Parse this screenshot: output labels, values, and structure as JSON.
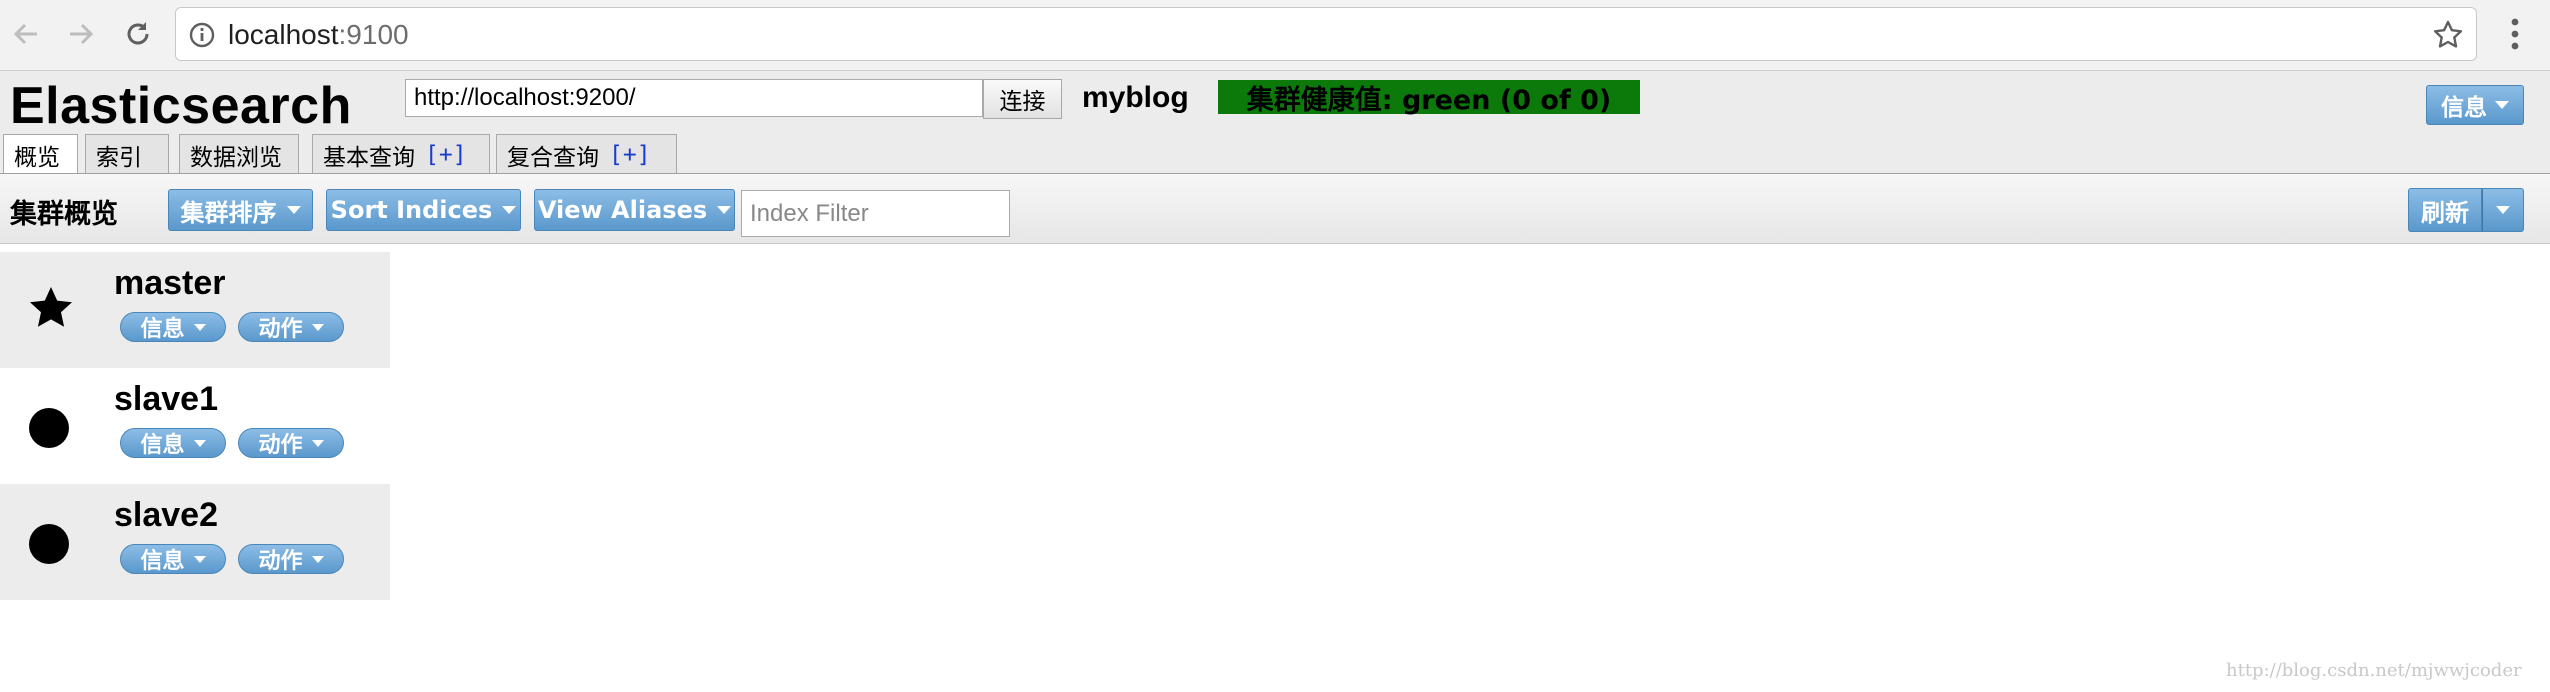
{
  "browser": {
    "url_host": "localhost",
    "url_port": ":9100",
    "icons": [
      "back-arrow-icon",
      "forward-arrow-icon",
      "reload-icon",
      "info-icon",
      "star-icon",
      "menu-dots-icon"
    ]
  },
  "header": {
    "brand": "Elasticsearch",
    "connection_url": "http://localhost:9200/",
    "connect_label": "连接",
    "cluster_name": "myblog",
    "health_text": "集群健康值: green (0 of 0)",
    "health_color": "#0b7a0b",
    "info_label": "信息"
  },
  "tabs": [
    {
      "label": "概览",
      "active": true
    },
    {
      "label": "索引"
    },
    {
      "label": "数据浏览"
    },
    {
      "label": "基本查询",
      "plus": "[+]"
    },
    {
      "label": "复合查询",
      "plus": "[+]"
    }
  ],
  "toolbar": {
    "title": "集群概览",
    "sort_cluster_label": "集群排序",
    "sort_indices_label": "Sort Indices",
    "view_aliases_label": "View Aliases",
    "index_filter_placeholder": "Index Filter",
    "refresh_label": "刷新"
  },
  "nodes": [
    {
      "name": "master",
      "icon": "star-icon",
      "info_label": "信息",
      "action_label": "动作"
    },
    {
      "name": "slave1",
      "icon": "circle-icon",
      "info_label": "信息",
      "action_label": "动作"
    },
    {
      "name": "slave2",
      "icon": "circle-icon",
      "info_label": "信息",
      "action_label": "动作"
    }
  ],
  "accent_color": "#5a98cc",
  "watermark": "http://blog.csdn.net/mjwwjcoder"
}
